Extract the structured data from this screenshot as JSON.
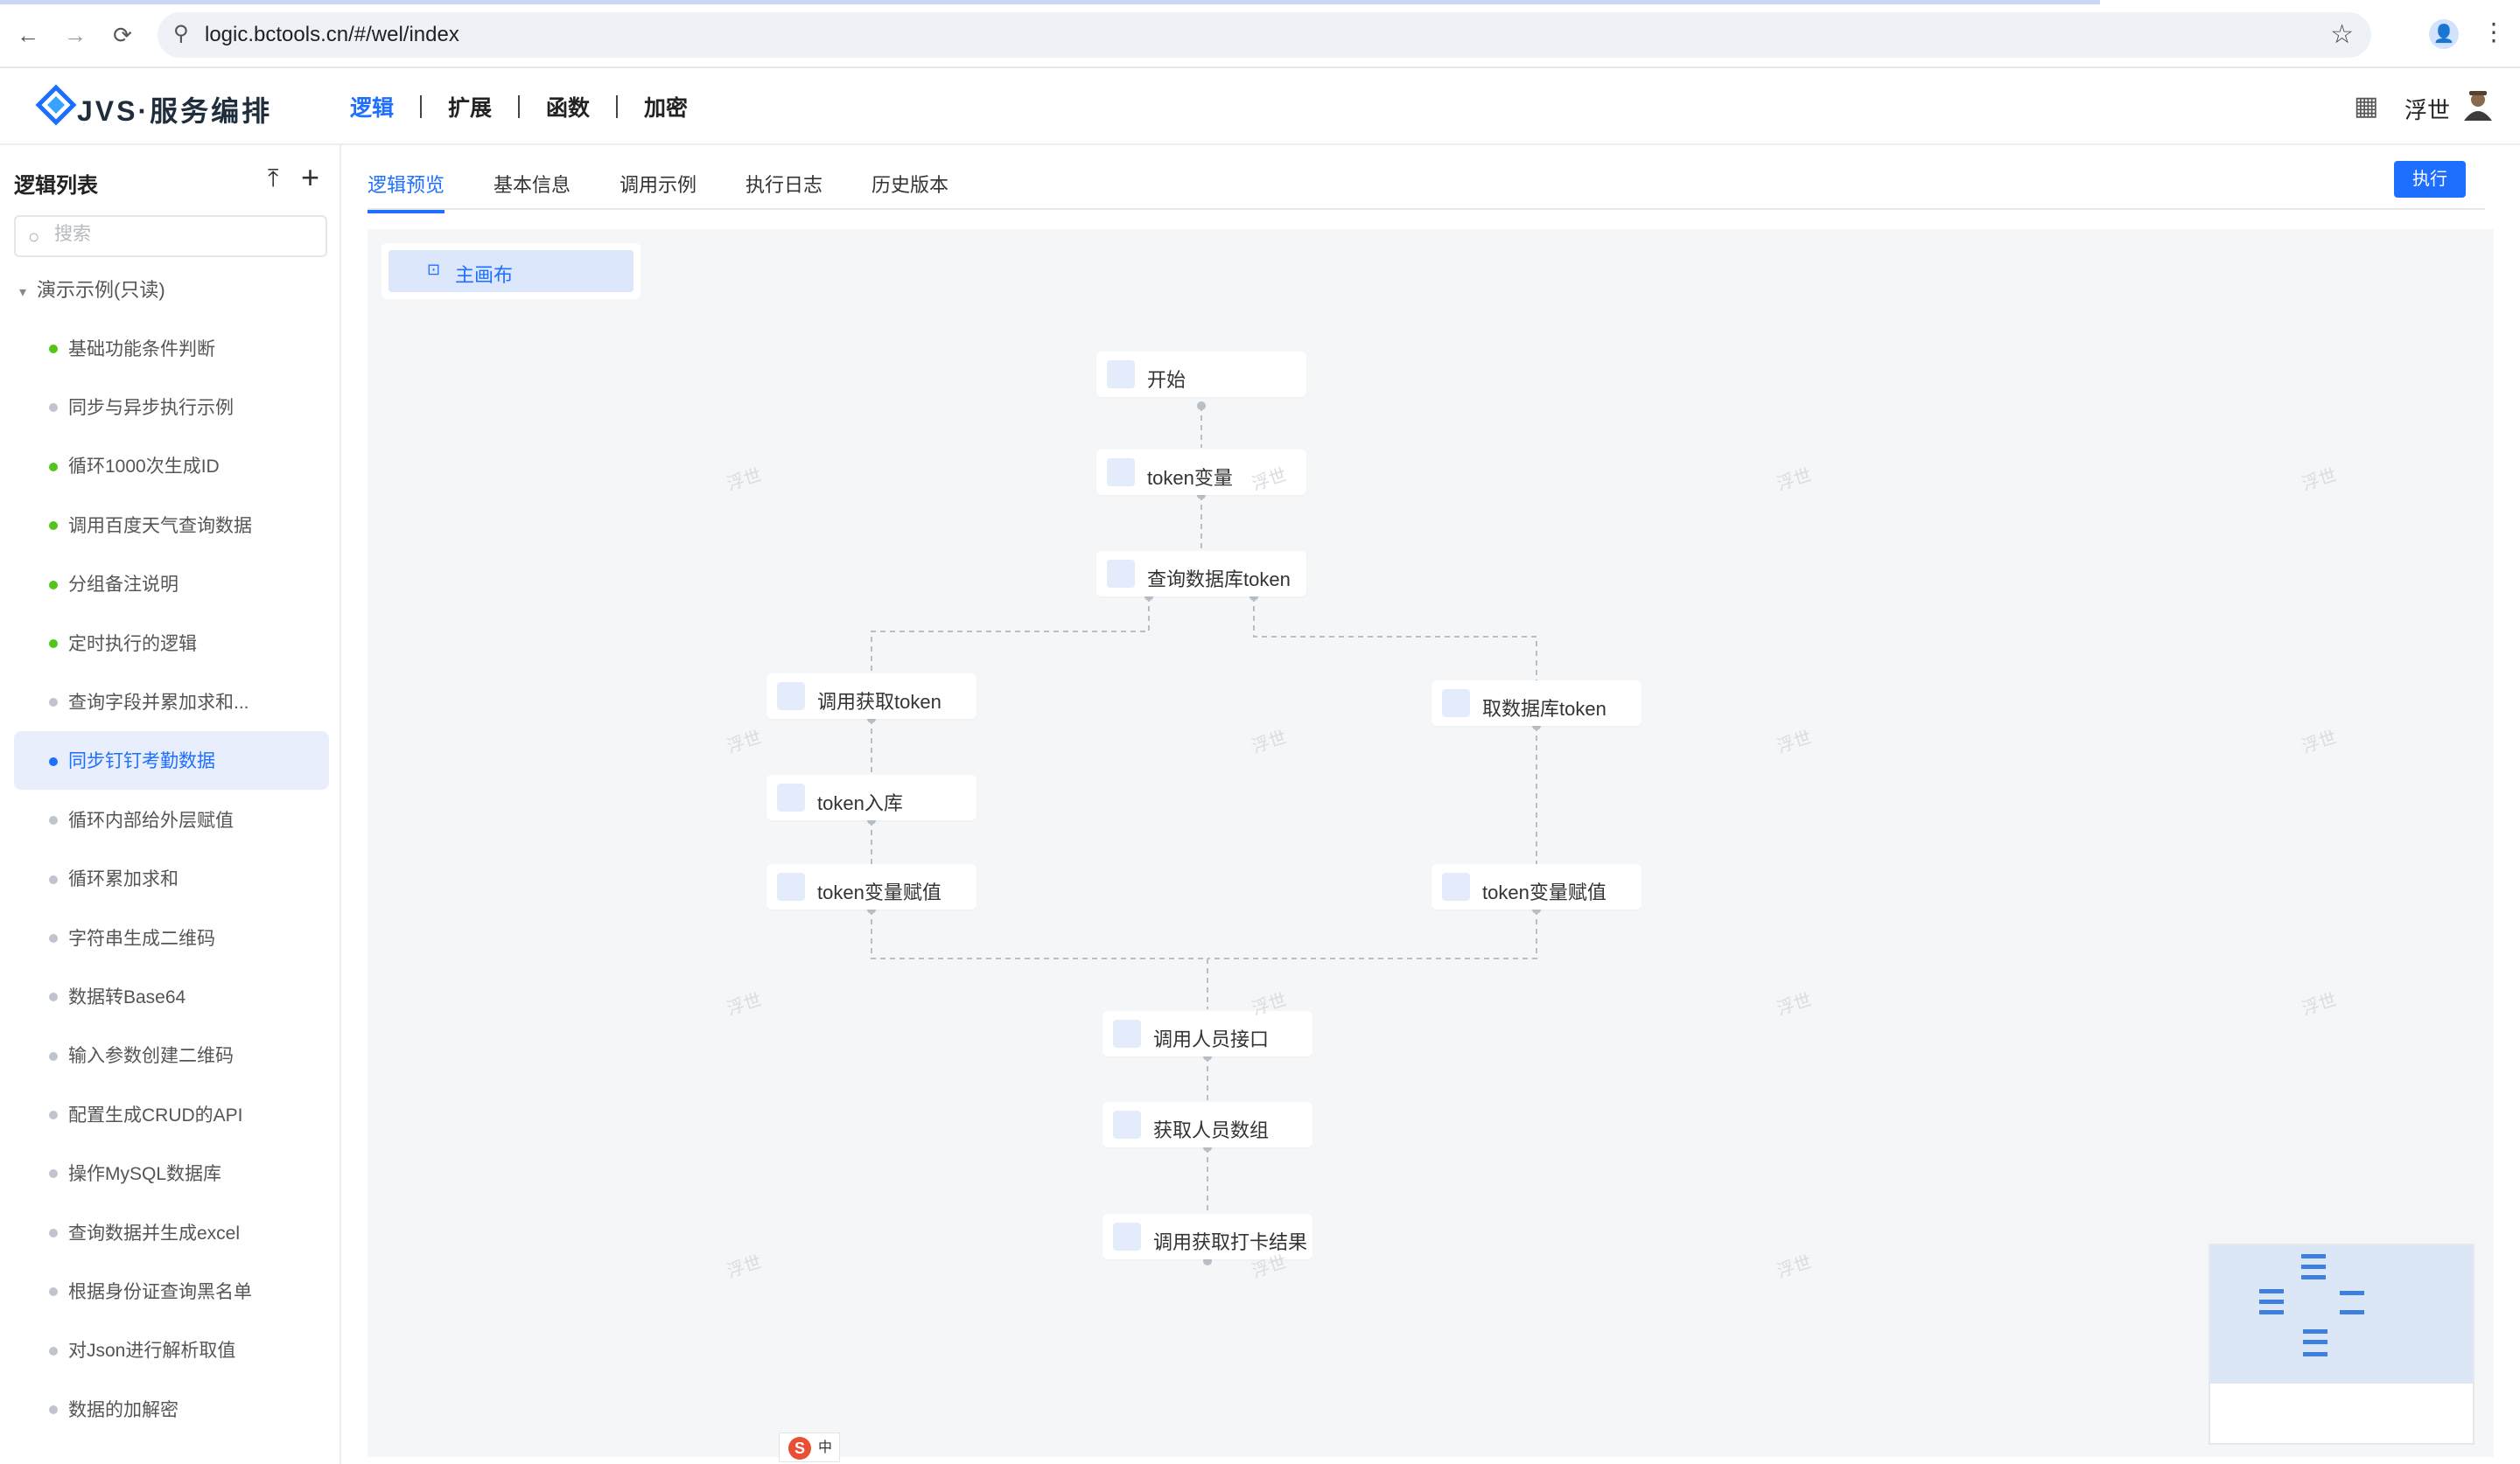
{
  "browser": {
    "url": "logic.bctools.cn/#/wel/index",
    "back_icon": "←",
    "forward_icon": "→",
    "reload_icon": "⟳",
    "site_icon": "⚲",
    "star_icon": "☆",
    "profile_icon": "👤",
    "menu_icon": "⋮"
  },
  "header": {
    "logo_text": "JVS·服务编排",
    "nav": [
      {
        "label": "逻辑",
        "active": true
      },
      {
        "label": "扩展"
      },
      {
        "label": "函数"
      },
      {
        "label": "加密"
      }
    ],
    "apps_icon": "▦",
    "user_name": "浮世"
  },
  "sidebar": {
    "title": "逻辑列表",
    "upload_icon": "⤒",
    "add_icon": "+",
    "search_icon": "○",
    "search_placeholder": "搜索",
    "group_caret": "▾",
    "group_label": "演示示例(只读)",
    "items": [
      {
        "label": "基础功能条件判断",
        "status_color": "#52c41a"
      },
      {
        "label": "同步与异步执行示例",
        "status_color": "#c0c4cc"
      },
      {
        "label": "循环1000次生成ID",
        "status_color": "#52c41a"
      },
      {
        "label": "调用百度天气查询数据",
        "status_color": "#52c41a"
      },
      {
        "label": "分组备注说明",
        "status_color": "#52c41a"
      },
      {
        "label": "定时执行的逻辑",
        "status_color": "#52c41a"
      },
      {
        "label": "查询字段并累加求和...",
        "status_color": "#c0c4cc"
      },
      {
        "label": "同步钉钉考勤数据",
        "status_color": "#1e6fff",
        "active": true
      },
      {
        "label": "循环内部给外层赋值",
        "status_color": "#c0c4cc"
      },
      {
        "label": "循环累加求和",
        "status_color": "#c0c4cc"
      },
      {
        "label": "字符串生成二维码",
        "status_color": "#c0c4cc"
      },
      {
        "label": "数据转Base64",
        "status_color": "#c0c4cc"
      },
      {
        "label": "输入参数创建二维码",
        "status_color": "#c0c4cc"
      },
      {
        "label": "配置生成CRUD的API",
        "status_color": "#c0c4cc"
      },
      {
        "label": "操作MySQL数据库",
        "status_color": "#c0c4cc"
      },
      {
        "label": "查询数据并生成excel",
        "status_color": "#c0c4cc"
      },
      {
        "label": "根据身份证查询黑名单",
        "status_color": "#c0c4cc"
      },
      {
        "label": "对Json进行解析取值",
        "status_color": "#c0c4cc"
      },
      {
        "label": "数据的加解密",
        "status_color": "#c0c4cc"
      }
    ]
  },
  "tabs": [
    {
      "label": "逻辑预览",
      "active": true
    },
    {
      "label": "基本信息"
    },
    {
      "label": "调用示例"
    },
    {
      "label": "执行日志"
    },
    {
      "label": "历史版本"
    }
  ],
  "run_label": "执行",
  "canvas": {
    "tab_icon": "⊡",
    "tab_label": "主画布",
    "watermark": "浮世",
    "nodes": [
      {
        "id": "start",
        "label": "开始"
      },
      {
        "id": "token_var",
        "label": "token变量"
      },
      {
        "id": "query_db_token",
        "label": "查询数据库token"
      },
      {
        "id": "call_get_token",
        "label": "调用获取token"
      },
      {
        "id": "token_store",
        "label": "token入库"
      },
      {
        "id": "token_assign_left",
        "label": "token变量赋值"
      },
      {
        "id": "get_db_token",
        "label": "取数据库token"
      },
      {
        "id": "token_assign_right",
        "label": "token变量赋值"
      },
      {
        "id": "call_user_api",
        "label": "调用人员接口"
      },
      {
        "id": "get_user_array",
        "label": "获取人员数组"
      },
      {
        "id": "call_punch_result",
        "label": "调用获取打卡结果"
      }
    ]
  },
  "ime": {
    "icon": "S",
    "mode": "中"
  },
  "colors": {
    "accent": "#1e6fff",
    "active_bg": "#e8eefb",
    "canvas_bg": "#f5f6f8",
    "node_icon_bg": "#e4ecfb"
  }
}
